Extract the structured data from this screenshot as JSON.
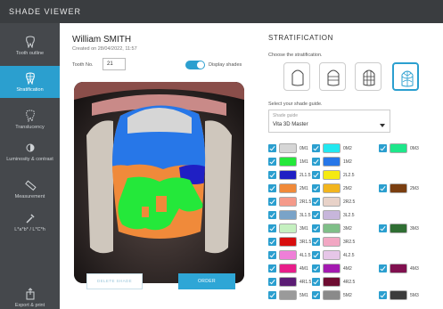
{
  "app": {
    "title": "SHADE VIEWER"
  },
  "sidebar": {
    "items": [
      {
        "label": "Tooth outline",
        "icon": "tooth-icon"
      },
      {
        "label": "Stratification",
        "icon": "stratification-icon",
        "active": true
      },
      {
        "label": "Translucency",
        "icon": "translucency-icon"
      },
      {
        "label": "Luminosity & contrast",
        "icon": "luminosity-icon"
      },
      {
        "label": "Measurement",
        "icon": "ruler-icon"
      },
      {
        "label": "L*a*b* / L*C*h",
        "icon": "pipette-icon"
      },
      {
        "label": "Export & print",
        "icon": "export-icon"
      }
    ]
  },
  "patient": {
    "name": "William SMITH",
    "created": "Created on 28/04/2022, 11:57",
    "tooth_label": "Tooth No.",
    "tooth_value": "21",
    "display_shades_label": "Display shades",
    "display_shades_on": true
  },
  "actions": {
    "delete": "DELETE SHADE",
    "order": "ORDER"
  },
  "stratification": {
    "title": "STRATIFICATION",
    "choose_label": "Choose the stratification.",
    "options": [
      {
        "icon": "single-layer-icon",
        "selected": false
      },
      {
        "icon": "three-horizontal-layers-icon",
        "selected": false
      },
      {
        "icon": "grid-layers-icon",
        "selected": false
      },
      {
        "icon": "detailed-layers-icon",
        "selected": true
      }
    ],
    "select_guide_label": "Select your shade guide.",
    "guide_placeholder": "Shade guide",
    "guide_value": "Vita 3D Master"
  },
  "shades": [
    [
      {
        "label": "0M1",
        "color": "#d6d6d6"
      },
      {
        "label": "0M2",
        "color": "#22e8f0"
      },
      {
        "label": "0M3",
        "color": "#1ee68a"
      }
    ],
    [
      {
        "label": "1M1",
        "color": "#24e83a"
      },
      {
        "label": "1M2",
        "color": "#2777e8"
      }
    ],
    [
      {
        "label": "2L1.5",
        "color": "#1f1fc4"
      },
      {
        "label": "2L2.5",
        "color": "#f5ea12"
      }
    ],
    [
      {
        "label": "2M1",
        "color": "#f08a3a"
      },
      {
        "label": "2M2",
        "color": "#f2b51e"
      },
      {
        "label": "2M3",
        "color": "#7a3e10"
      }
    ],
    [
      {
        "label": "2R1.5",
        "color": "#f59a8a"
      },
      {
        "label": "2R2.5",
        "color": "#e8d2c8"
      }
    ],
    [
      {
        "label": "3L1.5",
        "color": "#7aa3c8"
      },
      {
        "label": "3L2.5",
        "color": "#c7b6db"
      }
    ],
    [
      {
        "label": "3M1",
        "color": "#c5f0c0"
      },
      {
        "label": "3M2",
        "color": "#7fbf88"
      },
      {
        "label": "3M3",
        "color": "#2f6e33"
      }
    ],
    [
      {
        "label": "3R1.5",
        "color": "#d80e0e"
      },
      {
        "label": "3R2.5",
        "color": "#f2a7c3"
      }
    ],
    [
      {
        "label": "4L1.5",
        "color": "#ef7fd8"
      },
      {
        "label": "4L2.5",
        "color": "#e6c6e8"
      }
    ],
    [
      {
        "label": "4M1",
        "color": "#e81e8a"
      },
      {
        "label": "4M2",
        "color": "#a31ab0"
      },
      {
        "label": "4M3",
        "color": "#80104f"
      }
    ],
    [
      {
        "label": "4R1.5",
        "color": "#5b1c74"
      },
      {
        "label": "4R2.5",
        "color": "#6e0d31"
      }
    ],
    [
      {
        "label": "5M1",
        "color": "#9a9a9a"
      },
      {
        "label": "5M2",
        "color": "#8a8a8a"
      },
      {
        "label": "5M3",
        "color": "#3c3c3c"
      }
    ]
  ],
  "colors": {
    "accent": "#2b9fcf",
    "titlebar": "#3a3d40",
    "sidebar": "#45484c"
  }
}
